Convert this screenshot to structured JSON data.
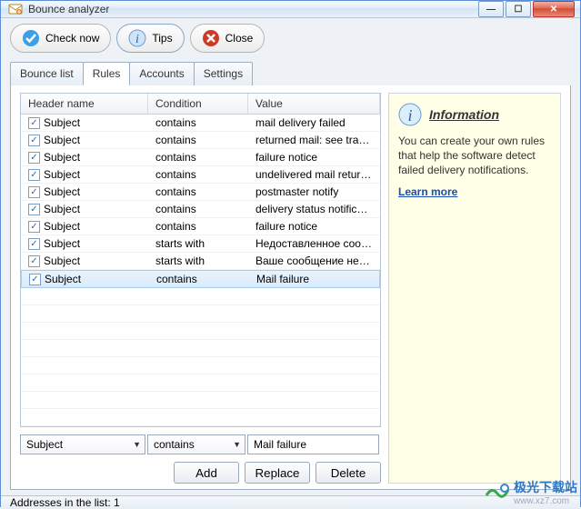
{
  "title": "Bounce analyzer",
  "toolbar": {
    "check_now": "Check now",
    "tips": "Tips",
    "close": "Close"
  },
  "tabs": [
    "Bounce list",
    "Rules",
    "Accounts",
    "Settings"
  ],
  "active_tab": 1,
  "columns": {
    "header": "Header name",
    "condition": "Condition",
    "value": "Value"
  },
  "rules": [
    {
      "header": "Subject",
      "condition": "contains",
      "value": "mail delivery failed",
      "checked": true
    },
    {
      "header": "Subject",
      "condition": "contains",
      "value": "returned mail: see transcript fo...",
      "checked": true
    },
    {
      "header": "Subject",
      "condition": "contains",
      "value": "failure notice",
      "checked": true
    },
    {
      "header": "Subject",
      "condition": "contains",
      "value": "undelivered mail returned to se...",
      "checked": true
    },
    {
      "header": "Subject",
      "condition": "contains",
      "value": "postmaster notify",
      "checked": true
    },
    {
      "header": "Subject",
      "condition": "contains",
      "value": "delivery status notification (fail...",
      "checked": true
    },
    {
      "header": "Subject",
      "condition": "contains",
      "value": "failure notice",
      "checked": true
    },
    {
      "header": "Subject",
      "condition": "starts with",
      "value": "Недоставленное сообщение",
      "checked": true
    },
    {
      "header": "Subject",
      "condition": "starts with",
      "value": "Ваше сообщение не доставл...",
      "checked": true
    },
    {
      "header": "Subject",
      "condition": "contains",
      "value": "Mail failure",
      "checked": true
    }
  ],
  "selected_index": 9,
  "editor": {
    "header": "Subject",
    "condition": "contains",
    "value": "Mail failure"
  },
  "buttons": {
    "add": "Add",
    "replace": "Replace",
    "delete": "Delete"
  },
  "info": {
    "title": "Information",
    "body": "You can create your own rules that help the software detect failed delivery notifications.",
    "link": "Learn more"
  },
  "status": "Addresses in the list:  1",
  "watermark": {
    "line1": "极光下载站",
    "line2": "www.xz7.com"
  }
}
